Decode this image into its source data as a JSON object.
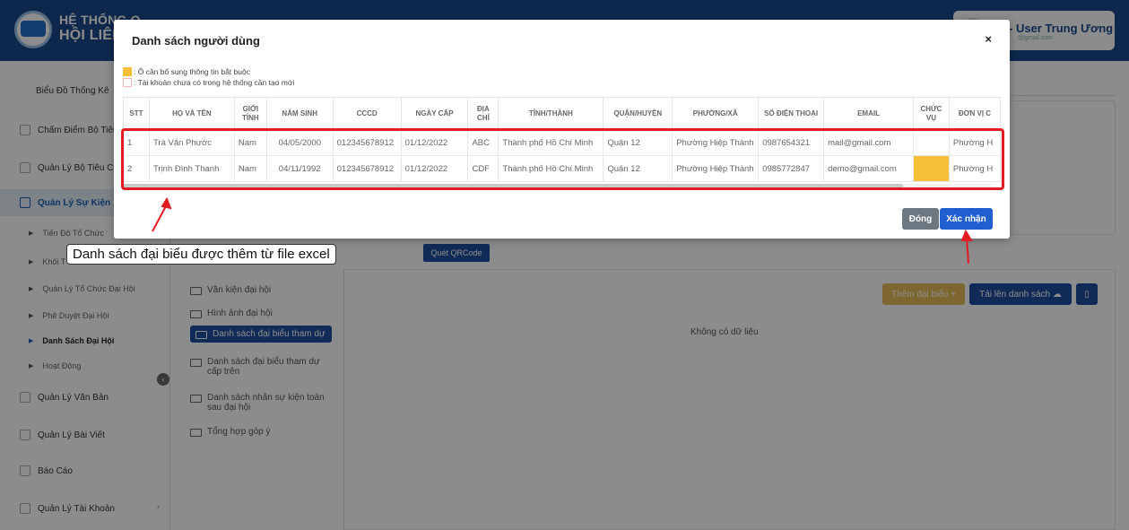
{
  "app": {
    "title_line1": "HỆ THỐNG QUẢN LÝ VÀ ĐIỀU HÀNH",
    "title_line2": "HỘI LIÊN",
    "user_name": "- User Trung Ương",
    "user_email": "@gmail.com"
  },
  "sidebar": {
    "items": [
      {
        "label": "Biểu Đồ Thống Kê"
      },
      {
        "label": "Chấm Điểm Bộ Tiêu C"
      },
      {
        "label": "Quản Lý Bộ Tiêu Chí"
      },
      {
        "label": "Quản Lý Sự Kiện"
      },
      {
        "label": "Quản Lý Văn Bản"
      },
      {
        "label": "Quản Lý Bài Viết"
      },
      {
        "label": "Báo Cáo"
      },
      {
        "label": "Quản Lý Tài Khoản"
      }
    ],
    "subitems": [
      {
        "label": "Tiến Độ Tổ Chức"
      },
      {
        "label": "Khối T"
      },
      {
        "label": "Quản Lý Tổ Chức Đại Hội"
      },
      {
        "label": "Phê Duyệt Đại Hội"
      },
      {
        "label": "Danh Sách Đại Hội"
      },
      {
        "label": "Hoạt Động"
      }
    ],
    "collapse_icon": "‹"
  },
  "folders": [
    {
      "label": "Văn kiện đại hội"
    },
    {
      "label": "Hình ảnh đại hội"
    },
    {
      "label": "Danh sách đại biểu tham dự"
    },
    {
      "label": "Danh sách đại biểu tham dự cấp trên"
    },
    {
      "label": "Danh sách nhân sự kiện toàn sau đại hội"
    },
    {
      "label": "Tổng hợp góp ý"
    }
  ],
  "main": {
    "qr_button": "Quét QRCode",
    "add_delegate_button": "Thêm đại biểu +",
    "upload_button": "Tải lên danh sách ☁",
    "no_data": "Không có dữ liệu",
    "file_icon": "▯"
  },
  "modal": {
    "title": "Danh sách người dùng",
    "close_icon": "×",
    "legend_yellow": ": Ô cần bổ sung thông tin bắt buộc",
    "legend_pink": ": Tài khoản chưa có trong hệ thống cần tạo mới",
    "columns": [
      "STT",
      "HỌ VÀ TÊN",
      "GIỚI TÍNH",
      "NĂM SINH",
      "CCCD",
      "NGÀY CẤP",
      "ĐỊA CHỈ",
      "TỈNH/THÀNH",
      "QUẬN/HUYỆN",
      "PHƯỜNG/XÃ",
      "SỐ ĐIỆN THOẠI",
      "EMAIL",
      "CHỨC VỤ",
      "ĐƠN VỊ C"
    ],
    "rows": [
      [
        "1",
        "Trà Văn Phước",
        "Nam",
        "04/05/2000",
        "012345678912",
        "01/12/2022",
        "ABC",
        "Thành phố Hồ Chí Minh",
        "Quận 12",
        "Phường Hiệp Thành",
        "0987654321",
        "mail@gmail.com",
        "",
        "Phường H"
      ],
      [
        "2",
        "Trịnh Đình Thanh",
        "Nam",
        "04/11/1992",
        "012345678912",
        "01/12/2022",
        "CDF",
        "Thành phố Hồ Chí Minh",
        "Quận 12",
        "Phường Hiệp Thành",
        "0985772847",
        "demo@gmail.com",
        "",
        "Phường H"
      ]
    ],
    "close_button": "Đóng",
    "confirm_button": "Xác nhận"
  },
  "annotation": {
    "text": "Danh sách đại biểu được thêm từ file excel"
  },
  "colors": {
    "primary": "#1f4fa0",
    "required_highlight": "#f6c137",
    "annotation_red": "#e21c23"
  }
}
